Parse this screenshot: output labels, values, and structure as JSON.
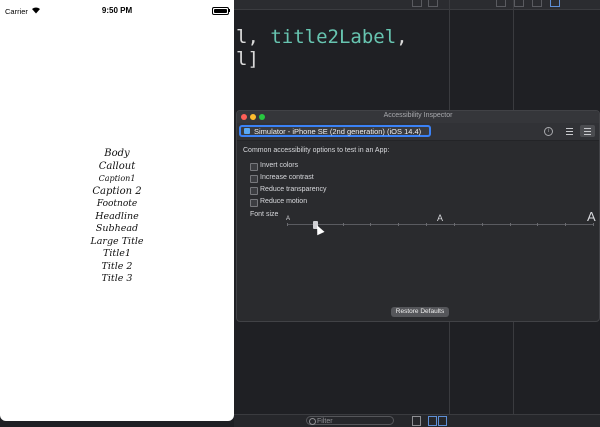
{
  "simulator": {
    "status": {
      "carrier": "Carrier",
      "time": "9:50 PM"
    },
    "labels": [
      "Body",
      "Callout",
      "Caption1",
      "Caption 2",
      "Footnote",
      "Headline",
      "Subhead",
      "Large Title",
      "Title1",
      "Title 2",
      "Title 3"
    ]
  },
  "xcode": {
    "code_line1_prefix": "l, ",
    "code_line1_ident": "title2Label",
    "code_line1_suffix": ",",
    "code_line2": "l]",
    "filter_placeholder": "Filter"
  },
  "inspector": {
    "window_title": "Accessibility Inspector",
    "target": "Simulator - iPhone SE (2nd generation) (iOS 14.4)",
    "heading": "Common accessibility options to test in an App:",
    "options": [
      {
        "label": "Invert colors",
        "checked": false
      },
      {
        "label": "Increase contrast",
        "checked": false
      },
      {
        "label": "Reduce transparency",
        "checked": false
      },
      {
        "label": "Reduce motion",
        "checked": false
      }
    ],
    "font_size_label": "Font size",
    "slider": {
      "min_glyph": "A",
      "mid_glyph": "A",
      "max_glyph": "A",
      "level": 0.1
    },
    "restore_button": "Restore Defaults"
  },
  "colors": {
    "accent": "#3b82f6",
    "code_ident": "#67c4b0",
    "background": "#1f2024"
  }
}
